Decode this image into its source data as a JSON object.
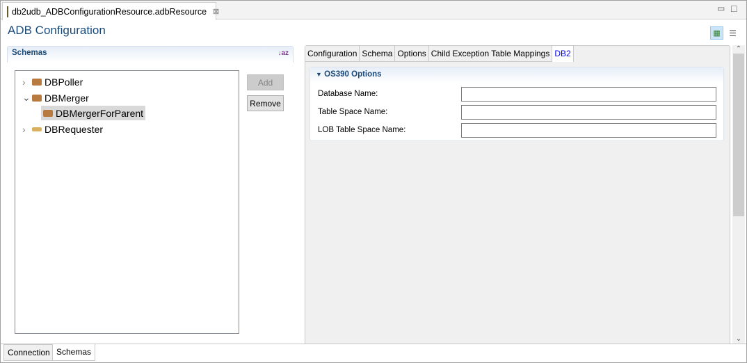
{
  "editor_tab": {
    "title": "db2udb_ADBConfigurationResource.adbResource",
    "close": "⊠"
  },
  "window_controls": {
    "minimize": "▭",
    "maximize": "□"
  },
  "page_title": "ADB Configuration",
  "schemas": {
    "header": "Schemas",
    "sort_icon": "↓az",
    "tree": [
      {
        "label": "DBPoller",
        "expander": "›"
      },
      {
        "label": "DBMerger",
        "expander": "⌄"
      },
      {
        "label": "DBMergerForParent",
        "expander": ""
      },
      {
        "label": "DBRequester",
        "expander": "›"
      }
    ],
    "add_label": "Add",
    "remove_label": "Remove"
  },
  "tabs": [
    "Configuration",
    "Schema",
    "Options",
    "Child Exception Table Mappings",
    "DB2"
  ],
  "os390": {
    "header": "OS390 Options",
    "fields": [
      {
        "label": "Database Name:",
        "value": ""
      },
      {
        "label": "Table Space Name:",
        "value": ""
      },
      {
        "label": "LOB Table Space Name:",
        "value": ""
      }
    ]
  },
  "bottom_tabs": [
    "Connection",
    "Schemas"
  ],
  "scrollbar": {
    "up": "⌃",
    "down": "⌄"
  }
}
